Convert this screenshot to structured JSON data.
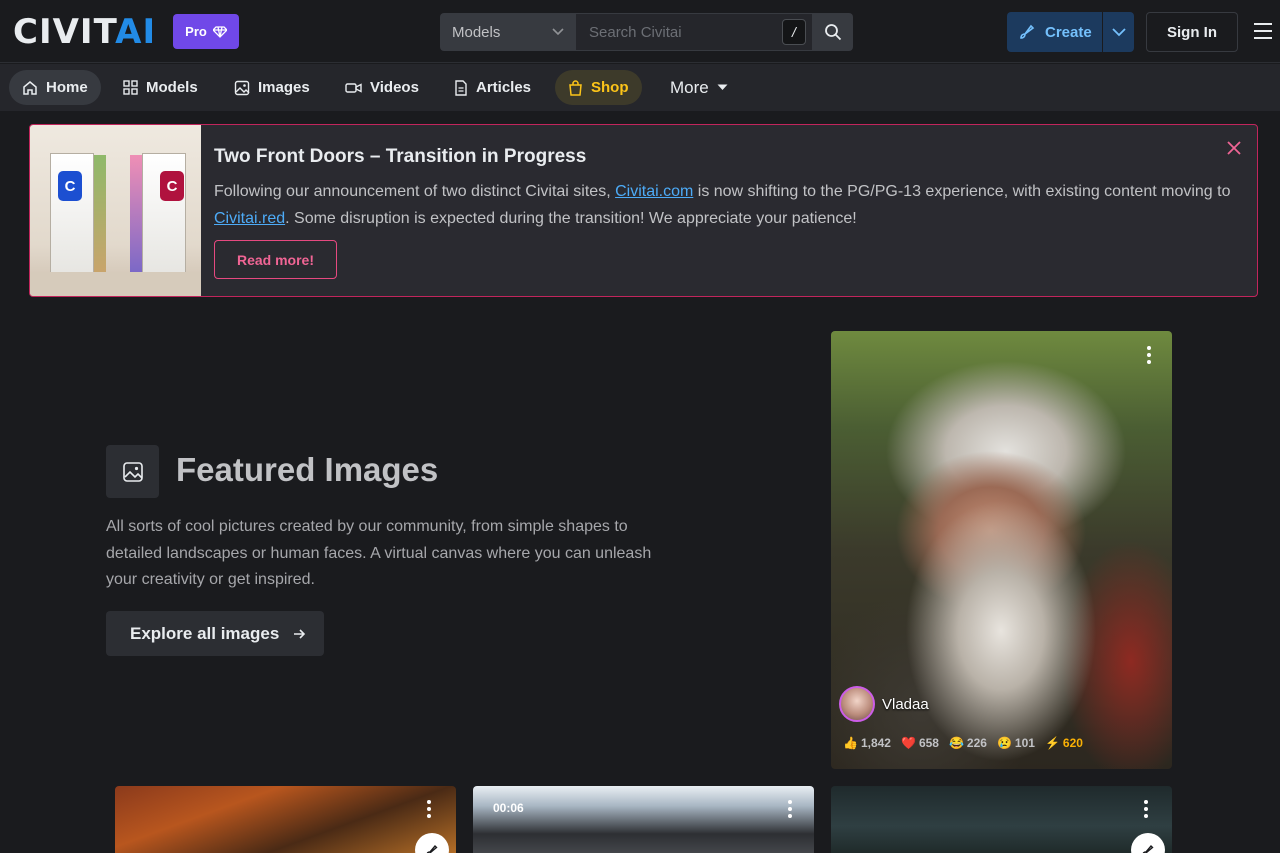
{
  "header": {
    "logo_text": "CIVIT",
    "logo_text_accent": "AI",
    "pro_label": "Pro",
    "search": {
      "category": "Models",
      "placeholder": "Search Civitai",
      "shortcut_key": "/"
    },
    "create_label": "Create",
    "signin_label": "Sign In"
  },
  "nav": {
    "items": [
      {
        "label": "Home",
        "icon": "home-icon"
      },
      {
        "label": "Models",
        "icon": "grid-icon"
      },
      {
        "label": "Images",
        "icon": "image-icon"
      },
      {
        "label": "Videos",
        "icon": "video-icon"
      },
      {
        "label": "Articles",
        "icon": "article-icon"
      },
      {
        "label": "Shop",
        "icon": "shopping-bag-icon"
      }
    ],
    "more_label": "More"
  },
  "announcement": {
    "title": "Two Front Doors – Transition in Progress",
    "text_before_link1": "Following our announcement of two distinct Civitai sites, ",
    "link1": "Civitai.com",
    "text_between": " is now shifting to the PG/PG-13 experience, with existing content moving to ",
    "link2": "Civitai.red",
    "text_after": ". Some disruption is expected during the transition! We appreciate your patience!",
    "read_more_label": "Read more!",
    "image_badges": [
      "C",
      "C"
    ]
  },
  "featured": {
    "title": "Featured Images",
    "description": "All sorts of cool pictures created by our community, from simple shapes to detailed landscapes or human faces. A virtual canvas where you can unleash your creativity or get inspired.",
    "explore_label": "Explore all images"
  },
  "main_card": {
    "username": "Vladaa",
    "reactions": {
      "like": "1,842",
      "heart": "658",
      "laugh": "226",
      "cry": "101",
      "buzz": "620"
    }
  },
  "bottom_cards": {
    "video_duration": "00:06"
  },
  "colors": {
    "background": "#1a1b1e",
    "brand_blue": "#228be6",
    "pro_purple": "#7048e8",
    "announce_border": "#c2255c",
    "shop_yellow": "#fcc419"
  }
}
